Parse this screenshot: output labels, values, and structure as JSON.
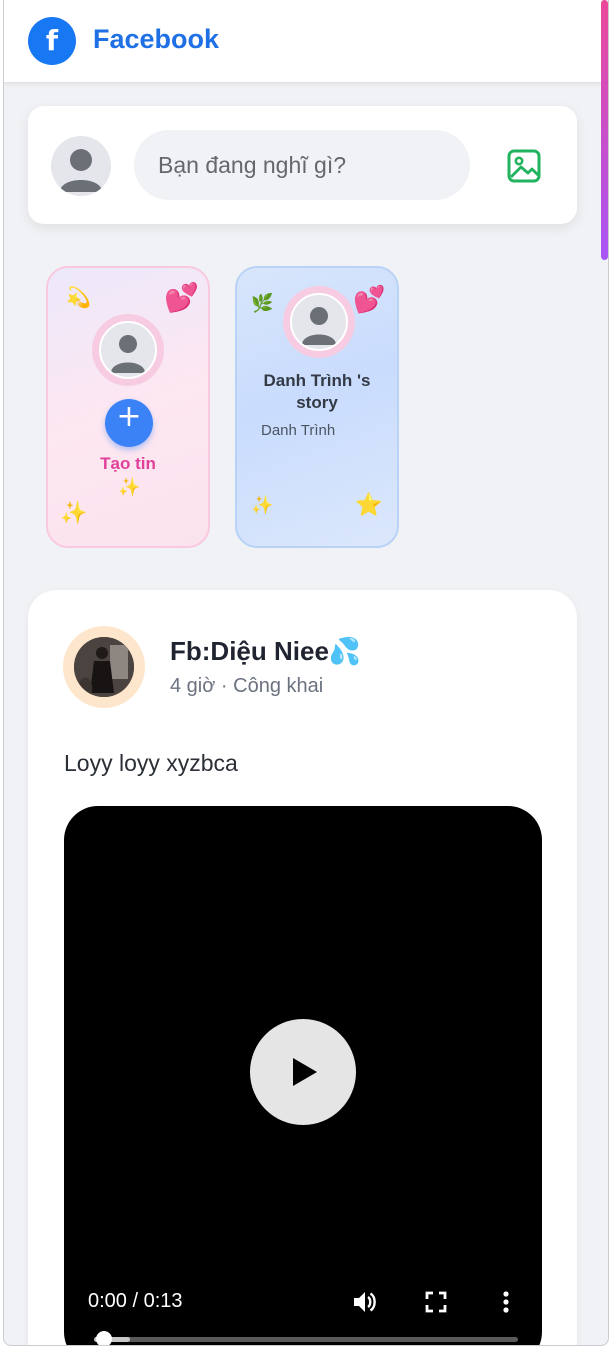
{
  "header": {
    "logo_letter": "f",
    "brand": "Facebook"
  },
  "composer": {
    "placeholder": "Bạn đang nghĩ gì?",
    "photo_icon": "image-icon"
  },
  "stories": {
    "create": {
      "label": "Tạo tin",
      "plus": "+",
      "emojis": [
        "💫",
        "💕",
        "✨",
        "✨"
      ]
    },
    "items": [
      {
        "title": "Danh Trình 's story",
        "author": "Danh Trình",
        "emojis": [
          "🌿",
          "💕",
          "✨",
          "⭐"
        ]
      }
    ]
  },
  "post": {
    "author": "Fb:Diệu Niee💦",
    "meta": "4 giờ · Công khai",
    "text": "Loyy loyy xyzbca",
    "video": {
      "time": "0:00 / 0:13",
      "progress": 0.02,
      "controls": [
        "volume-icon",
        "fullscreen-icon",
        "more-options-icon"
      ]
    }
  },
  "colors": {
    "brand": "#1877f2",
    "accent_pink": "#e0409a",
    "background": "#f1f2f5"
  }
}
